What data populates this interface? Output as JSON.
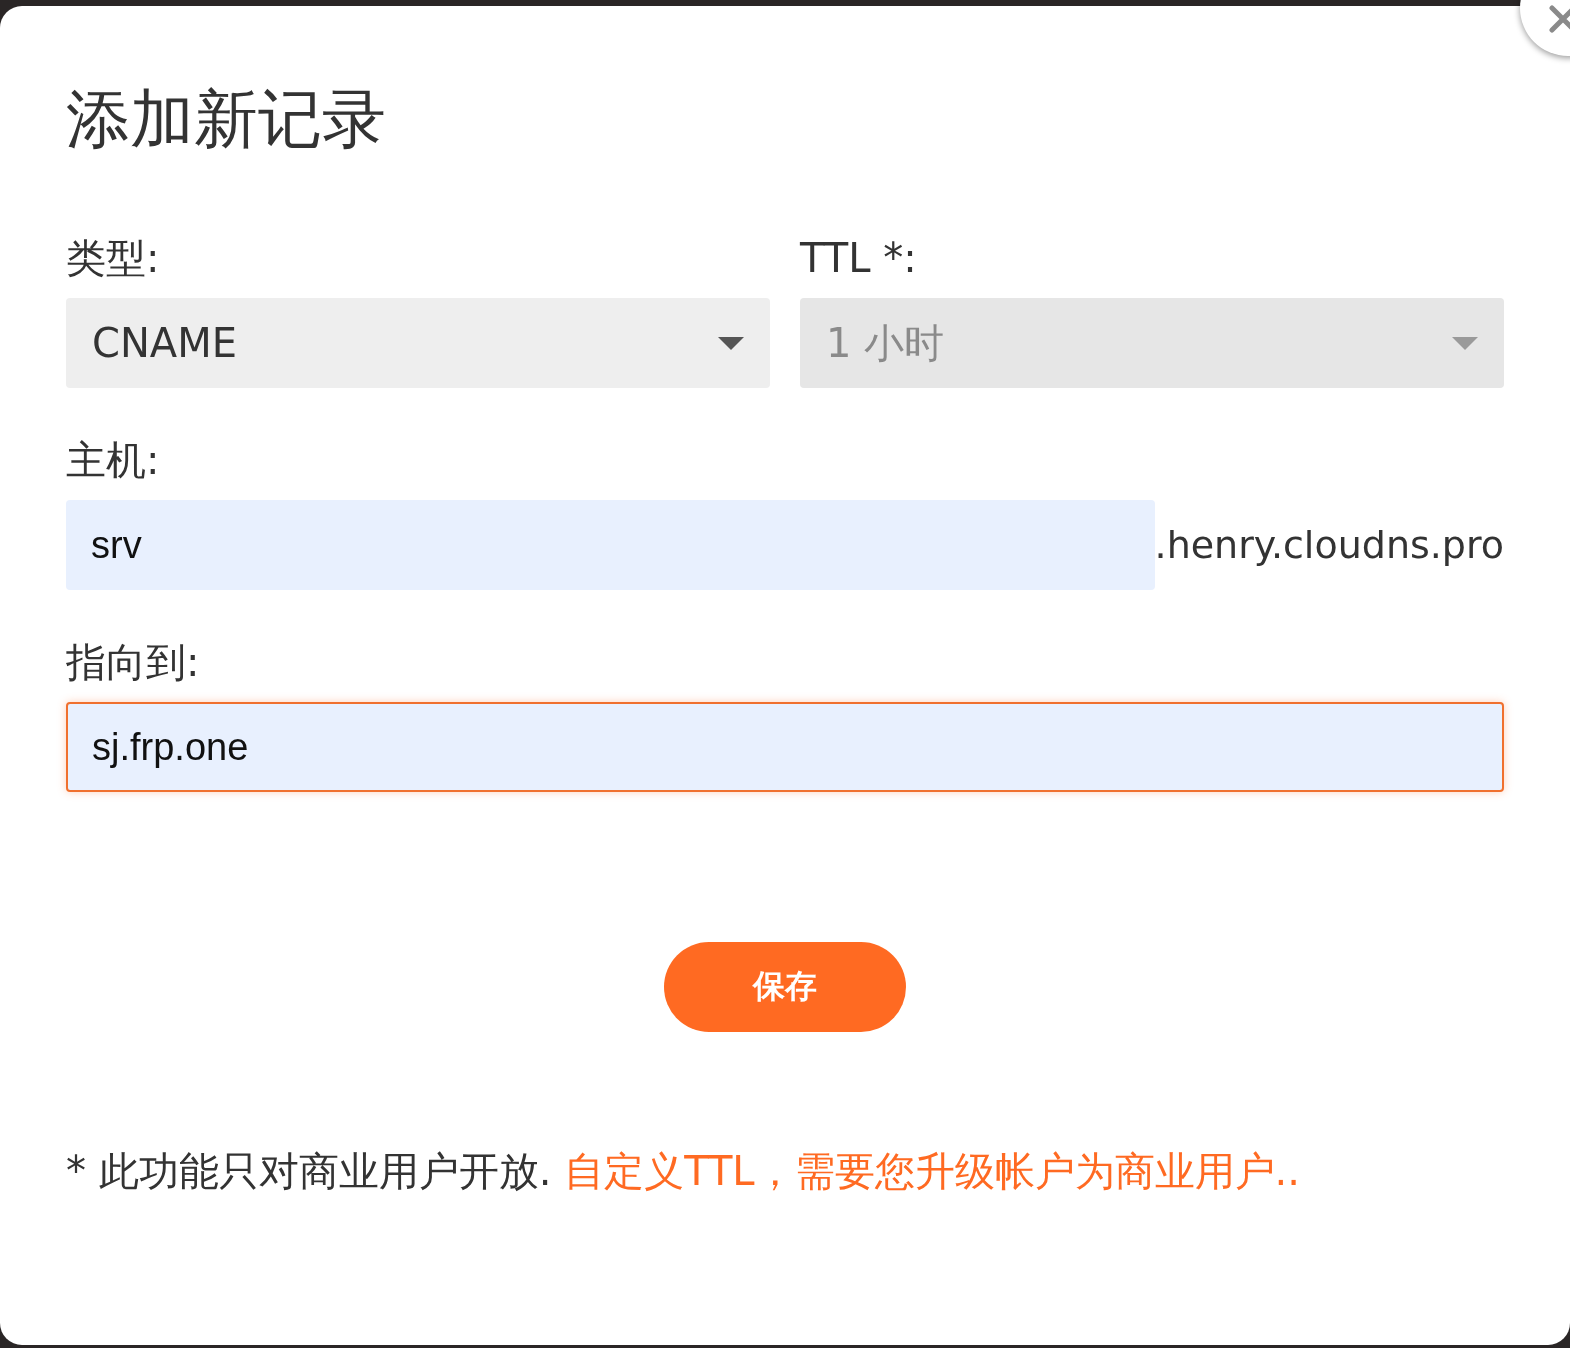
{
  "dialog": {
    "title": "添加新记录"
  },
  "selects": [
    {
      "label": "类型:",
      "value": "CNAME",
      "disabled": false
    },
    {
      "label": "TTL *:",
      "value": "1 小时",
      "disabled": true
    }
  ],
  "host": {
    "label": "主机:",
    "value": "srv",
    "suffix": ".henry.cloudns.pro",
    "focused": false
  },
  "target": {
    "label": "指向到:",
    "value": "sj.frp.one",
    "focused": true
  },
  "save_button": "保存",
  "note": {
    "text": "* 此功能只对商业用户开放.",
    "link": "自定义TTL，需要您升级帐户为商业用户.."
  }
}
